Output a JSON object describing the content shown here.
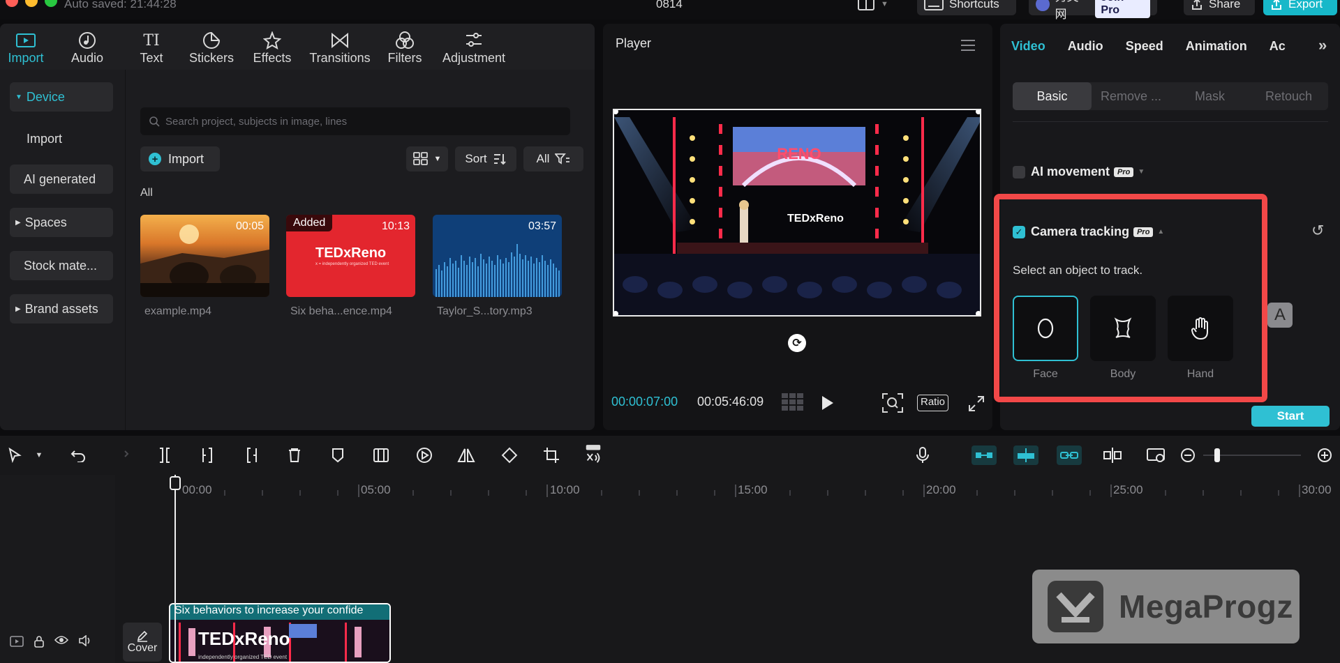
{
  "titlebar": {
    "autosave": "Auto saved: 21:44:28",
    "project_name": "0814",
    "shortcuts": "Shortcuts",
    "user_name": "秀英网",
    "join_pro": "Join Pro",
    "share": "Share",
    "export": "Export"
  },
  "media_tabs": [
    {
      "label": "Import",
      "icon": "import-icon"
    },
    {
      "label": "Audio",
      "icon": "audio-icon"
    },
    {
      "label": "Text",
      "icon": "text-icon"
    },
    {
      "label": "Stickers",
      "icon": "stickers-icon"
    },
    {
      "label": "Effects",
      "icon": "effects-icon"
    },
    {
      "label": "Transitions",
      "icon": "transitions-icon"
    },
    {
      "label": "Filters",
      "icon": "filters-icon"
    },
    {
      "label": "Adjustment",
      "icon": "adjustment-icon"
    }
  ],
  "sidebar": {
    "items": [
      "Device",
      "Import",
      "AI generated",
      "Spaces",
      "Stock mate...",
      "Brand assets"
    ]
  },
  "media": {
    "search_placeholder": "Search project, subjects in image, lines",
    "import_label": "Import",
    "sort_label": "Sort",
    "filter_label": "All",
    "all_label": "All",
    "items": [
      {
        "name": "example.mp4",
        "duration": "00:05",
        "added": ""
      },
      {
        "name": "Six beha...ence.mp4",
        "duration": "10:13",
        "added": "Added",
        "thumb_text": "TEDxReno",
        "thumb_sub": "x = independently organized TED event"
      },
      {
        "name": "Taylor_S...tory.mp3",
        "duration": "03:57",
        "added": ""
      }
    ]
  },
  "player": {
    "title": "Player",
    "current_time": "00:00:07:00",
    "total_time": "00:05:46:09",
    "ratio_label": "Ratio",
    "stage_sign": "RENO",
    "stage_logo": "TEDxReno"
  },
  "properties": {
    "tabs": [
      "Video",
      "Audio",
      "Speed",
      "Animation",
      "Ac"
    ],
    "subtabs": [
      "Basic",
      "Remove ...",
      "Mask",
      "Retouch"
    ],
    "ai_movement": "AI movement",
    "pro_badge": "Pro",
    "camera_tracking": "Camera tracking",
    "select_hint": "Select an object to track.",
    "track_options": [
      "Face",
      "Body",
      "Hand"
    ],
    "start_label": "Start",
    "text_badge": "A"
  },
  "timeline": {
    "ruler": [
      "00:00",
      "05:00",
      "10:00",
      "15:00",
      "20:00",
      "25:00",
      "30:00"
    ],
    "clip_title": "Six behaviors to increase your confide",
    "cover_label": "Cover",
    "clip_logo": "TEDxReno",
    "clip_sub": "independently organized TED event"
  },
  "watermark": "MegaProgz",
  "colors": {
    "accent": "#2fc0d3",
    "highlight": "#f24848",
    "panel": "#1c1c1f"
  }
}
